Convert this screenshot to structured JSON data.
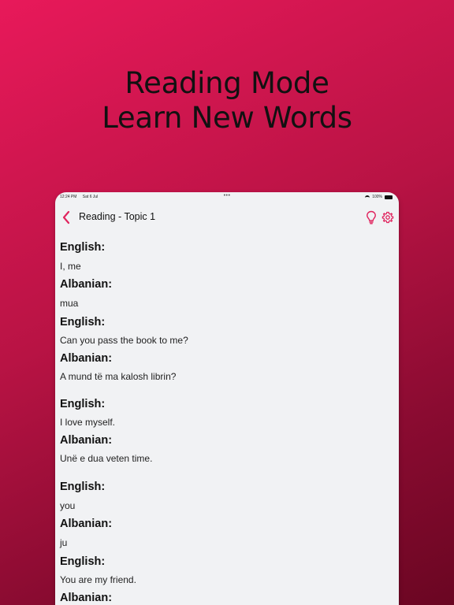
{
  "promo": {
    "line1": "Reading Mode",
    "line2": "Learn New Words"
  },
  "statusbar": {
    "time": "12:24 PM",
    "date": "Sat 6 Jul",
    "dots": "•••",
    "battery": "100%"
  },
  "navbar": {
    "title": "Reading - Topic 1"
  },
  "pairs": [
    {
      "english_label": "English:",
      "english": "I, me",
      "albanian_label": "Albanian:",
      "albanian": "mua"
    },
    {
      "english_label": "English:",
      "english": "Can you pass the book to me?",
      "albanian_label": "Albanian:",
      "albanian": "A mund të ma kalosh librin?"
    },
    {
      "english_label": "English:",
      "english": "I love myself.",
      "albanian_label": "Albanian:",
      "albanian": "Unë e dua veten time."
    },
    {
      "english_label": "English:",
      "english": "you",
      "albanian_label": "Albanian:",
      "albanian": "ju"
    },
    {
      "english_label": "English:",
      "english": "You are my friend.",
      "albanian_label": "Albanian:",
      "albanian": ""
    }
  ],
  "colors": {
    "accent": "#e0245e",
    "background_top": "#e8195a",
    "background_bottom": "#6a0622",
    "screen_bg": "#f1f2f4"
  },
  "icons": {
    "back": "chevron-left-icon",
    "hint": "lightbulb-icon",
    "settings": "gear-icon"
  }
}
